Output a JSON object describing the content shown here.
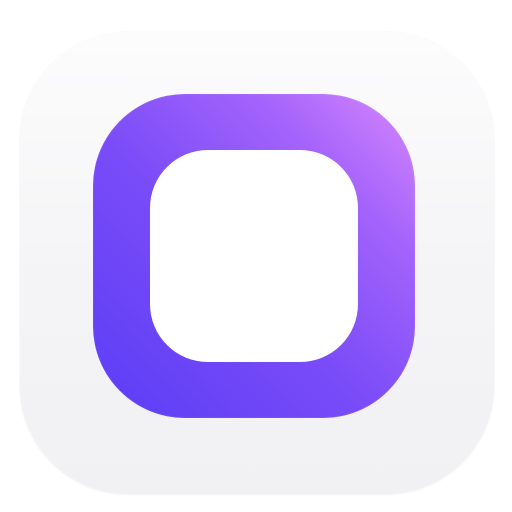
{
  "app_icon": {
    "icon_name": "rounded-square-outline-icon",
    "colors": {
      "tile_background": "#f4f4f6",
      "gradient_start": "#5a3df5",
      "gradient_mid": "#a463fb",
      "gradient_end": "#d888fd",
      "inner_fill": "#ffffff"
    }
  }
}
